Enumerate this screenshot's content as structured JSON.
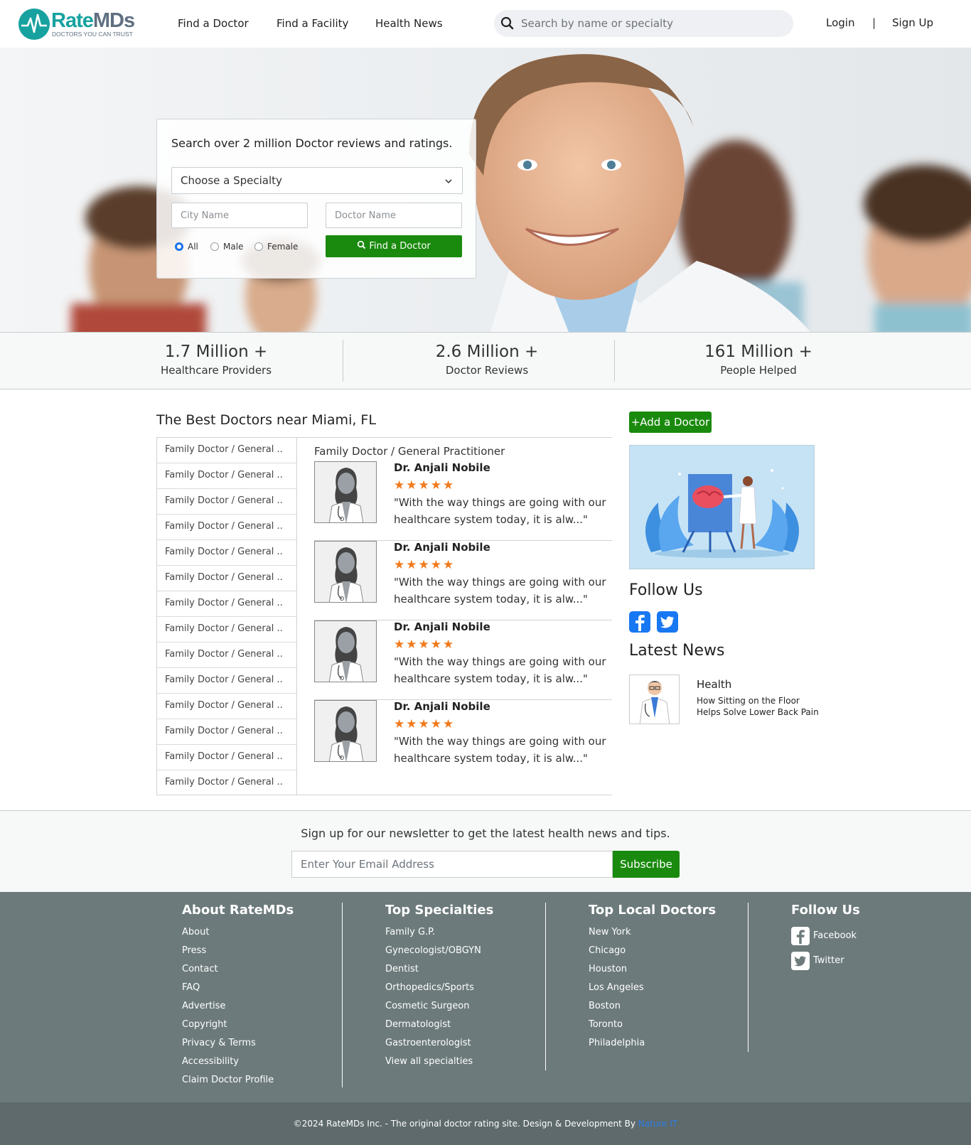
{
  "header": {
    "logo_name": "RateMDs",
    "logo_rate": "Rate",
    "logo_mds": "MDs",
    "logo_tagline": "DOCTORS YOU CAN TRUST",
    "nav": [
      "Find a Doctor",
      "Find a Facility",
      "Health News"
    ],
    "search_placeholder": "Search by name or specialty",
    "login": "Login",
    "separator": "|",
    "signup": "Sign Up"
  },
  "hero": {
    "title": "Search over 2 million Doctor reviews and ratings.",
    "specialty_select": "Choose a Specialty",
    "city_placeholder": "City Name",
    "doctor_placeholder": "Doctor Name",
    "gender_options": [
      "All",
      "Male",
      "Female"
    ],
    "gender_selected": "All",
    "find_button": "Find a Doctor"
  },
  "stats": [
    {
      "number": "1.7 Million +",
      "label": "Healthcare Providers"
    },
    {
      "number": "2.6 Million +",
      "label": "Doctor Reviews"
    },
    {
      "number": "161 Million +",
      "label": "People Helped"
    }
  ],
  "best_doctors": {
    "title": "The Best Doctors near Miami, FL",
    "categories": [
      "Family Doctor / General ..",
      "Family Doctor / General ..",
      "Family Doctor / General ..",
      "Family Doctor / General ..",
      "Family Doctor / General ..",
      "Family Doctor / General ..",
      "Family Doctor / General ..",
      "Family Doctor / General ..",
      "Family Doctor / General ..",
      "Family Doctor / General ..",
      "Family Doctor / General ..",
      "Family Doctor / General ..",
      "Family Doctor / General ..",
      "Family Doctor / General .."
    ],
    "list_heading": "Family Doctor / General Practitioner",
    "doctors": [
      {
        "name": "Dr. Anjali Nobile",
        "rating": 5,
        "stars": "★★★★★",
        "quote": "\"With the way things are going with our healthcare system today, it is alw...\""
      },
      {
        "name": "Dr. Anjali Nobile",
        "rating": 5,
        "stars": "★★★★★",
        "quote": "\"With the way things are going with our healthcare system today, it is alw...\""
      },
      {
        "name": "Dr. Anjali Nobile",
        "rating": 5,
        "stars": "★★★★★",
        "quote": "\"With the way things are going with our healthcare system today, it is alw...\""
      },
      {
        "name": "Dr. Anjali Nobile",
        "rating": 5,
        "stars": "★★★★★",
        "quote": "\"With the way things are going with our healthcare system today, it is alw...\""
      }
    ]
  },
  "sidebar": {
    "add_doctor": "+Add a Doctor",
    "follow_title": "Follow Us",
    "news_title": "Latest News",
    "news_category": "Health",
    "news_headline": "How Sitting on the Floor Helps Solve Lower Back Pain"
  },
  "newsletter": {
    "text": "Sign up for our newsletter to get the latest health news and tips.",
    "email_placeholder": "Enter Your Email Address",
    "subscribe": "Subscribe"
  },
  "footer": {
    "about_title": "About RateMDs",
    "about_links": [
      "About",
      "Press",
      "Contact",
      "FAQ",
      "Advertise",
      "Copyright",
      "Privacy & Terms",
      "Accessibility",
      "Claim Doctor Profile"
    ],
    "specialties_title": "Top Specialties",
    "specialties_links": [
      "Family G.P.",
      "Gynecologist/OBGYN",
      "Dentist",
      "Orthopedics/Sports",
      "Cosmetic Surgeon",
      "Dermatologist",
      "Gastroenterologist",
      "View all specialties"
    ],
    "local_title": "Top Local Doctors",
    "local_links": [
      "New York",
      "Chicago",
      "Houston",
      "Los Angeles",
      "Boston",
      "Toronto",
      "Philadelphia"
    ],
    "follow_title": "Follow Us",
    "follow_links": [
      "Facebook",
      "Twitter"
    ],
    "copyright": "©2024 RateMDs Inc. - The original doctor rating site. Design & Development By ",
    "credit": "Nature IT"
  },
  "colors": {
    "brand_teal": "#17a2a0",
    "button_green": "#1a8a0e",
    "star_orange": "#f07a1c",
    "facebook_blue": "#1877f2",
    "footer_gray": "#6c7a7b"
  }
}
